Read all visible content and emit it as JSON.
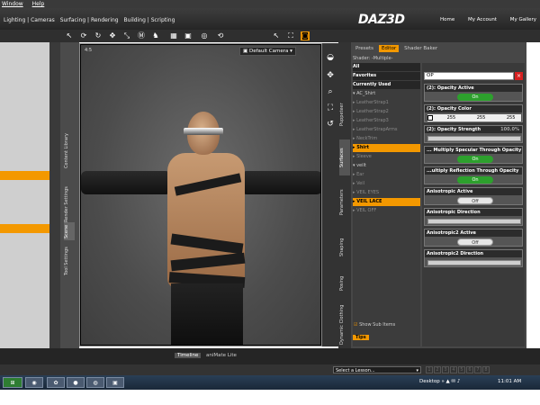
{
  "menubar": {
    "items": [
      "Window",
      "Help"
    ]
  },
  "header": {
    "tabs": [
      "Lighting | Cameras",
      "Surfacing | Rendering",
      "Building | Scripting"
    ],
    "logo": "DAZ3D",
    "links": [
      "Home",
      "My Account",
      "My Gallery"
    ]
  },
  "left_tabs": [
    "Content Library",
    "Render Settings",
    "Scene",
    "Tool Settings"
  ],
  "viewport": {
    "camera": "Default Camera",
    "label": "4:5"
  },
  "right_tabs": [
    "Puppeteer",
    "Surfaces",
    "Parameters",
    "Shaping",
    "Posing",
    "Dynamic Clothing"
  ],
  "shader_panel": {
    "tabs": [
      "Presets",
      "Editor",
      "Shader Baker"
    ],
    "shader_label": "Shader: -Multiple-",
    "tree": [
      {
        "label": "All",
        "kind": "head"
      },
      {
        "label": "Favorites",
        "kind": "head"
      },
      {
        "label": "Currently Used",
        "kind": "head"
      },
      {
        "label": "▾ AC_Shirt",
        "kind": "normal"
      },
      {
        "label": "  ▸ LeatherStrap1",
        "kind": "dim"
      },
      {
        "label": "  ▸ LeatherStrap2",
        "kind": "dim"
      },
      {
        "label": "  ▸ LeatherStrap3",
        "kind": "dim"
      },
      {
        "label": "  ▸ LeatherStrapArms",
        "kind": "dim"
      },
      {
        "label": "  ▸ NeckTrim",
        "kind": "dim"
      },
      {
        "label": "  ▸ Shirt",
        "kind": "sel"
      },
      {
        "label": "  ▸ Sleeve",
        "kind": "dim"
      },
      {
        "label": "▾ veilt",
        "kind": "normal"
      },
      {
        "label": "  ▸ Ear",
        "kind": "dim"
      },
      {
        "label": "  ▸ Veil",
        "kind": "dim"
      },
      {
        "label": "  ▸ VEIL EYES",
        "kind": "dim"
      },
      {
        "label": "  ▸ VEIL LACE",
        "kind": "sel"
      },
      {
        "label": "  ▸ VEIL OFF",
        "kind": "dim"
      }
    ],
    "search_value": "OP",
    "show_sub_items": "Show Sub Items",
    "tips": "Tips",
    "props": [
      {
        "title": "(2): Opacity Active",
        "type": "toggle",
        "value": "On"
      },
      {
        "title": "(2): Opacity Color",
        "type": "color",
        "r": "255",
        "g": "255",
        "b": "255"
      },
      {
        "title": "(2): Opacity Strength",
        "type": "slider",
        "value": "100.0%"
      },
      {
        "title": "... Multiply Specular Through Opacity",
        "type": "toggle",
        "value": "On"
      },
      {
        "title": "...ultiply Reflection Through Opacity",
        "type": "toggle",
        "value": "On"
      },
      {
        "title": "Anisotropic Active",
        "type": "toggle",
        "value": "Off"
      },
      {
        "title": "Anisotropic Direction",
        "type": "dropdown"
      },
      {
        "title": "Anisotropic2 Active",
        "type": "toggle",
        "value": "Off"
      },
      {
        "title": "Anisotropic2 Direction",
        "type": "dropdown"
      }
    ]
  },
  "timeline": {
    "tabs": [
      "Timeline",
      "aniMate Lite"
    ]
  },
  "lesson": {
    "placeholder": "Select a Lesson...",
    "pages": [
      "1",
      "2",
      "3",
      "4",
      "5",
      "6",
      "7",
      "8"
    ]
  },
  "taskbar": {
    "desktop": "Desktop",
    "clock": "11:01 AM"
  }
}
